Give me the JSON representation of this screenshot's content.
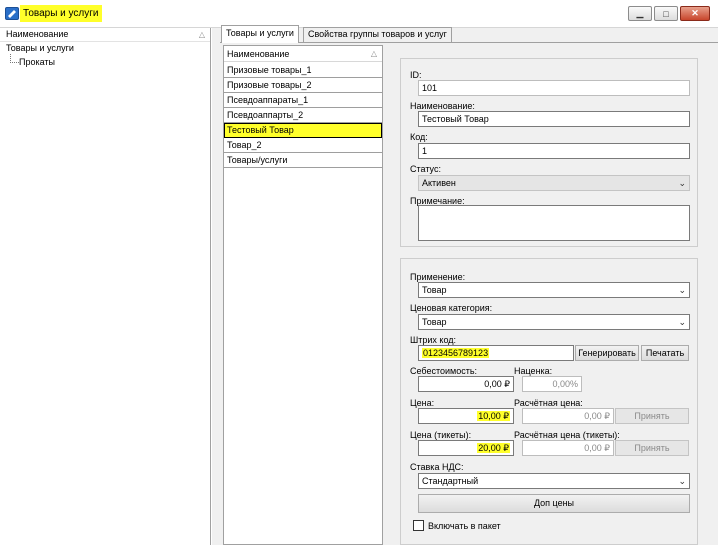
{
  "window": {
    "title": "Товары и услуги",
    "controls": {
      "minimize": "▁",
      "maximize": "□",
      "close": "✕"
    }
  },
  "tree": {
    "header": "Наименование",
    "root": "Товары и услуги",
    "child": "Прокаты"
  },
  "tabs": [
    "Товары и услуги",
    "Свойства группы товаров и услуг"
  ],
  "goods": {
    "header": "Наименование",
    "items": [
      "Призовые товары_1",
      "Призовые товары_2",
      "Псевдоаппараты_1",
      "Псевдоаппарты_2",
      "Тестовый Товар",
      "Товар_2",
      "Товары/услуги"
    ],
    "selected_index": 4
  },
  "form": {
    "id_label": "ID:",
    "id_value": "101",
    "name_label": "Наименование:",
    "name_value": "Тестовый Товар",
    "code_label": "Код:",
    "code_value": "1",
    "status_label": "Статус:",
    "status_value": "Активен",
    "note_label": "Примечание:",
    "note_value": "",
    "application_label": "Применение:",
    "application_value": "Товар",
    "price_category_label": "Ценовая категория:",
    "price_category_value": "Товар",
    "barcode_label": "Штрих код:",
    "barcode_value": "0123456789123",
    "generate_button": "Генерировать",
    "print_button": "Печатать",
    "cost_label": "Себестоимость:",
    "cost_value": "0,00 ₽",
    "markup_label": "Наценка:",
    "markup_value": "0,00%",
    "price_label": "Цена:",
    "price_value": "10,00 ₽",
    "calc_price_label": "Расчётная цена:",
    "calc_price_value": "0,00 ₽",
    "accept_button": "Принять",
    "ticket_price_label": "Цена (тикеты):",
    "ticket_price_value": "20,00 ₽",
    "calc_ticket_price_label": "Расчётная цена (тикеты):",
    "calc_ticket_price_value": "0,00 ₽",
    "accept_button_2": "Принять",
    "vat_label": "Ставка НДС:",
    "vat_value": "Стандартный",
    "extra_prices_button": "Доп цены",
    "include_in_package_label": "Включать в пакет"
  },
  "colors": {
    "highlight": "#ffff2a",
    "panel": "#f0f0f0",
    "icon": "#2a6fc9"
  }
}
